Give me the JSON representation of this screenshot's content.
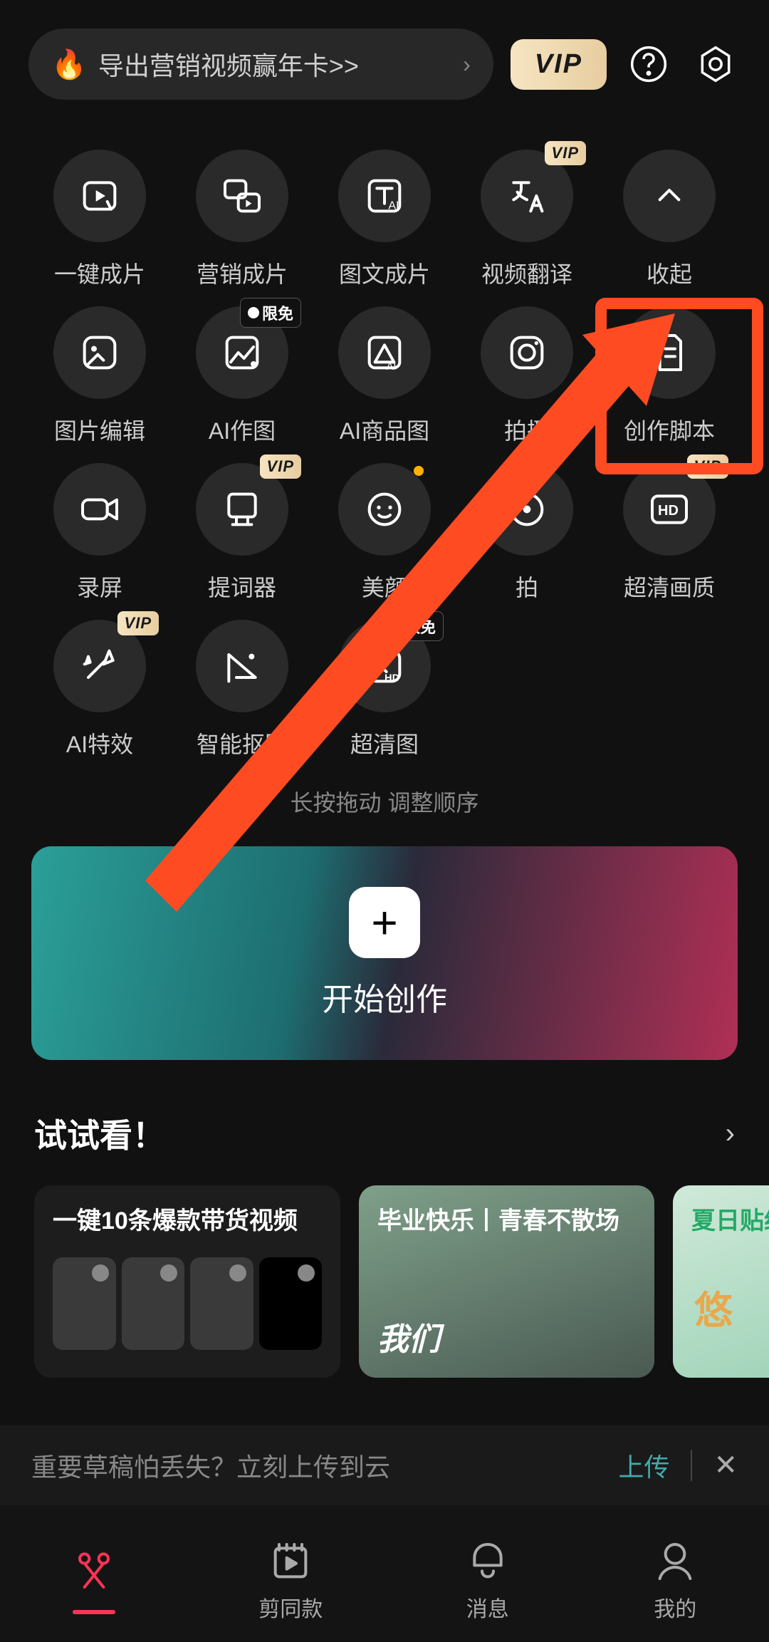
{
  "topbar": {
    "promo_text": "导出营销视频赢年卡>>",
    "vip_label": "VIP"
  },
  "tools": [
    {
      "label": "一键成片",
      "icon": "video-flash",
      "tag": null
    },
    {
      "label": "营销成片",
      "icon": "marketing",
      "tag": null
    },
    {
      "label": "图文成片",
      "icon": "text-ai",
      "tag": null
    },
    {
      "label": "视频翻译",
      "icon": "translate",
      "tag": "vip"
    },
    {
      "label": "收起",
      "icon": "collapse",
      "tag": null
    },
    {
      "label": "图片编辑",
      "icon": "pic-edit",
      "tag": null
    },
    {
      "label": "AI作图",
      "icon": "ai-draw",
      "tag": "free"
    },
    {
      "label": "AI商品图",
      "icon": "ai-product",
      "tag": null
    },
    {
      "label": "拍摄",
      "icon": "camera",
      "tag": null
    },
    {
      "label": "创作脚本",
      "icon": "script",
      "tag": null
    },
    {
      "label": "录屏",
      "icon": "record",
      "tag": null
    },
    {
      "label": "提词器",
      "icon": "prompter",
      "tag": "vip"
    },
    {
      "label": "美颜",
      "icon": "beauty",
      "tag": null,
      "dot": true
    },
    {
      "label": "拍",
      "icon": "snap",
      "tag": null
    },
    {
      "label": "超清画质",
      "icon": "hd",
      "tag": "vip"
    },
    {
      "label": "AI特效",
      "icon": "ai-fx",
      "tag": "vip"
    },
    {
      "label": "智能抠图",
      "icon": "cutout",
      "tag": null
    },
    {
      "label": "超清图",
      "icon": "hd-pic",
      "tag": "free"
    }
  ],
  "hint": "长按拖动    调整顺序",
  "create_label": "开始创作",
  "section_title": "试试看！",
  "cards": [
    {
      "title": "一键10条爆款带货视频",
      "kind": "dark",
      "overlay": ""
    },
    {
      "title": "毕业快乐丨青春不散场",
      "kind": "img1",
      "overlay": "我们"
    },
    {
      "title": "夏日贴纸",
      "kind": "img2",
      "overlay": "悠"
    }
  ],
  "upload": {
    "text": "重要草稿怕丢失？立刻上传到云",
    "action": "上传"
  },
  "nav": [
    {
      "label": "",
      "icon": "scissors",
      "active": true
    },
    {
      "label": "剪同款",
      "icon": "template",
      "active": false
    },
    {
      "label": "消息",
      "icon": "bell",
      "active": false
    },
    {
      "label": "我的",
      "icon": "user",
      "active": false
    }
  ]
}
